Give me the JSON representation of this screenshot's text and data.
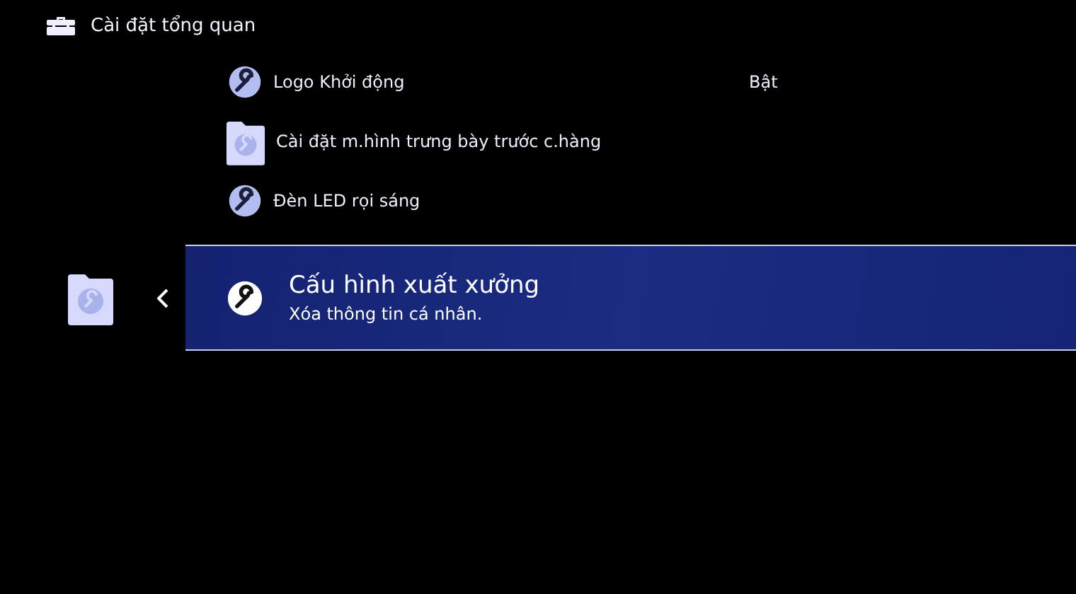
{
  "header": {
    "title": "Cài đặt tổng quan"
  },
  "items": [
    {
      "kind": "setting",
      "label": "Logo Khởi động",
      "value": "Bật",
      "selected": false
    },
    {
      "kind": "folder",
      "label": "Cài đặt m.hình trưng bày trước c.hàng",
      "selected": false
    },
    {
      "kind": "setting",
      "label": "Đèn LED rọi sáng",
      "selected": false
    },
    {
      "kind": "setting",
      "label": "Cấu hình xuất xưởng",
      "description": "Xóa thông tin cá nhân.",
      "selected": true
    }
  ]
}
